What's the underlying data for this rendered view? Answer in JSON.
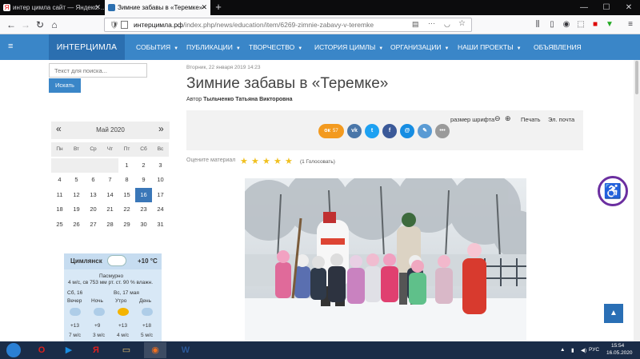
{
  "browser": {
    "tabs": [
      {
        "title": "интер цимла сайт — Яндекс: ...",
        "icon": "yandex-icon",
        "active": false
      },
      {
        "title": "Зимние забавы в «Теремке»",
        "icon": "site-favicon",
        "active": true
      }
    ],
    "new_tab": "+",
    "window_controls": {
      "minimize": "—",
      "maximize": "☐",
      "close": "✕"
    },
    "url_host": "интерцимла.рф",
    "url_path": "/index.php/news/education/item/6269-zimnie-zabavy-v-teremke"
  },
  "site": {
    "brand": "ИНТЕРЦИМЛА",
    "nav": [
      {
        "label": "СОБЫТИЯ",
        "caret": "▼"
      },
      {
        "label": "ПУБЛИКАЦИИ",
        "caret": "▼"
      },
      {
        "label": "ТВОРЧЕСТВО",
        "caret": "▼"
      },
      {
        "label": "ИСТОРИЯ ЦИМЛЫ",
        "caret": "▼"
      },
      {
        "label": "ОРГАНИЗАЦИИ",
        "caret": "▼"
      },
      {
        "label": "НАШИ ПРОЕКТЫ",
        "caret": "▼"
      },
      {
        "label": "ОБЪЯВЛЕНИЯ",
        "caret": ""
      }
    ]
  },
  "search": {
    "placeholder": "Текст для поиска...",
    "button": "Искать"
  },
  "calendar": {
    "prev": "«",
    "next": "»",
    "title": "Май 2020",
    "dow": [
      "Пн",
      "Вт",
      "Ср",
      "Чт",
      "Пт",
      "Сб",
      "Вс"
    ],
    "weeks": [
      [
        "",
        "",
        "",
        "",
        "1",
        "2",
        "3"
      ],
      [
        "4",
        "5",
        "6",
        "7",
        "8",
        "9",
        "10"
      ],
      [
        "11",
        "12",
        "13",
        "14",
        "15",
        "16",
        "17"
      ],
      [
        "18",
        "19",
        "20",
        "21",
        "22",
        "23",
        "24"
      ],
      [
        "25",
        "26",
        "27",
        "28",
        "29",
        "30",
        "31"
      ]
    ],
    "today": "16"
  },
  "weather": {
    "city": "Цимлянск",
    "temp": "+10 °C",
    "condition": "Пасмурно",
    "details": "4 м/с, св  753 мм рт. ст.  90 % влажн.",
    "day1": "Сб, 16",
    "day2": "Вс, 17 мая",
    "periods": [
      {
        "name": "Вечер",
        "temp": "+13",
        "wind": "7 м/с",
        "icon": "cloud-rain-icon"
      },
      {
        "name": "Ночь",
        "temp": "+9",
        "wind": "3 м/с",
        "icon": "cloud-icon"
      },
      {
        "name": "Утро",
        "temp": "+13",
        "wind": "4 м/с",
        "icon": "sun-icon"
      },
      {
        "name": "День",
        "temp": "+18",
        "wind": "5 м/с",
        "icon": "cloud-rain-icon"
      }
    ]
  },
  "article": {
    "date": "Вторник, 22 января 2019 14:23",
    "title": "Зимние забавы в «Теремке»",
    "author_label": "Автор",
    "author": "Тыльченко Татьяна Викторовна",
    "font_size_label": "размер шрифта",
    "print": "Печать",
    "email": "Эл. почта",
    "share": [
      {
        "name": "odnoklassniki",
        "label": "ок",
        "count": "57",
        "color": "#f39a1f"
      },
      {
        "name": "vk",
        "label": "vk",
        "color": "#4a76a8"
      },
      {
        "name": "twitter",
        "label": "t",
        "color": "#1da1f2"
      },
      {
        "name": "facebook",
        "label": "f",
        "color": "#3b5998"
      },
      {
        "name": "mail",
        "label": "@",
        "color": "#168de2"
      },
      {
        "name": "livejournal",
        "label": "✎",
        "color": "#5a9bd4"
      },
      {
        "name": "more",
        "label": "•••",
        "color": "#9a9a9a"
      }
    ],
    "rating_label": "Оцените материал",
    "rating_value": 5,
    "rating_count": "(1 Голосовать)"
  },
  "taskbar": {
    "lang": "РУС",
    "time": "15:54",
    "date": "16.05.2020"
  },
  "colors": {
    "brand": "#3a86c8",
    "brand_dark": "#2b6fb0",
    "taskbar": "#1a2c48"
  }
}
